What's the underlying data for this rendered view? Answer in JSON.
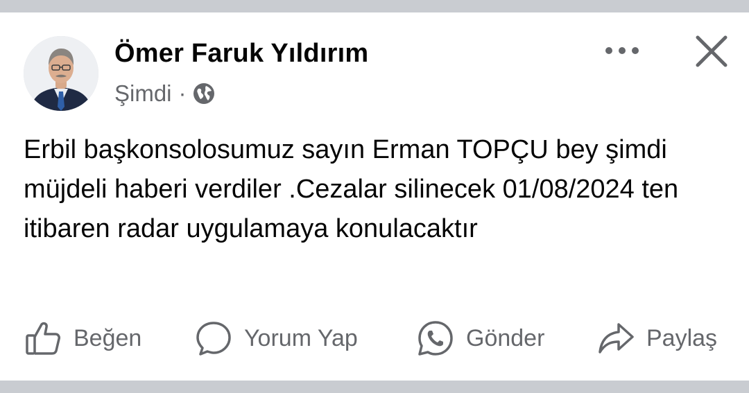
{
  "post": {
    "author": "Ömer Faruk Yıldırım",
    "time": "Şimdi",
    "separator": "·",
    "privacy_icon": "globe-icon",
    "text": "Erbil başkonsolosumuz sayın Erman TOPÇU bey şimdi müjdeli haberi verdiler .Cezalar silinecek 01/08/2024 ten itibaren radar uygulamaya konulacaktır"
  },
  "header_actions": {
    "more_icon": "more-dots-icon",
    "close_icon": "close-icon"
  },
  "actions": [
    {
      "label": "Beğen",
      "icon": "thumbs-up-icon"
    },
    {
      "label": "Yorum Yap",
      "icon": "comment-bubble-icon"
    },
    {
      "label": "Gönder",
      "icon": "whatsapp-icon"
    },
    {
      "label": "Paylaş",
      "icon": "share-arrow-icon"
    }
  ],
  "colors": {
    "text_primary": "#050505",
    "text_secondary": "#65676b",
    "divider_bar": "#c9ccd1"
  }
}
